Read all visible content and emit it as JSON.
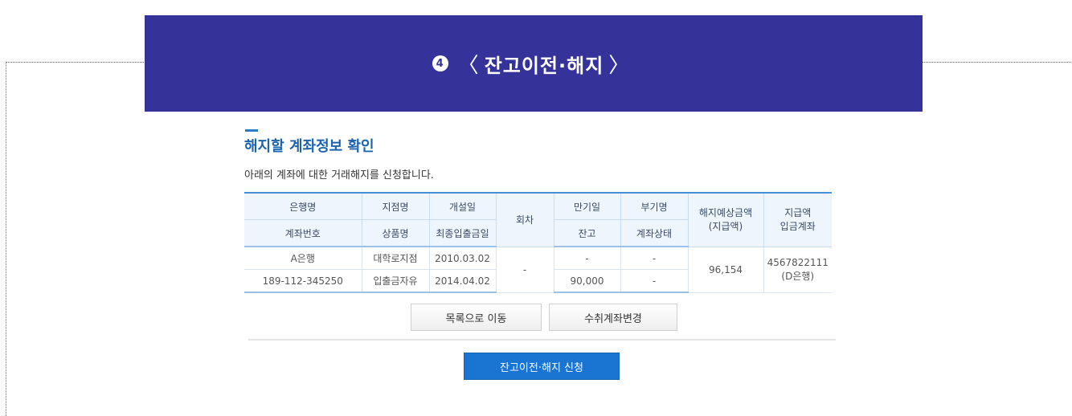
{
  "banner": {
    "step_number": "4",
    "open": "〈",
    "title": "잔고이전·해지",
    "close": "〉"
  },
  "section": {
    "title": "해지할 계좌정보 확인",
    "description": "아래의 계좌에 대한 거래해지를 신청합니다."
  },
  "table": {
    "headers": {
      "bank": "은행명",
      "account_no": "계좌번호",
      "branch": "지점명",
      "product": "상품명",
      "open_date": "개설일",
      "last_deposit": "최종입출금일",
      "round": "회차",
      "maturity": "만기일",
      "balance": "잔고",
      "deputy": "부기명",
      "status": "계좌상태",
      "expected_amount": "해지예상금액",
      "expected_amount_sub": "(지급액)",
      "payout": "지급액",
      "payout_account": "입금계좌"
    },
    "row": {
      "bank": "A은행",
      "account_no": "189-112-345250",
      "branch": "대학로지점",
      "product": "입출금자유",
      "open_date": "2010.03.02",
      "last_deposit": "2014.04.02",
      "round": "-",
      "maturity": "-",
      "balance": "90,000",
      "deputy": "-",
      "status": "-",
      "expected_amount": "96,154",
      "payout_account": "4567822111",
      "payout_bank": "(D은행)"
    }
  },
  "buttons": {
    "list": "목록으로 이동",
    "change_account": "수취계좌변경",
    "submit": "잔고이전·해지 신청"
  },
  "colors": {
    "banner": "#35339a",
    "accent": "#1a74d1",
    "amount": "#e8413b"
  }
}
